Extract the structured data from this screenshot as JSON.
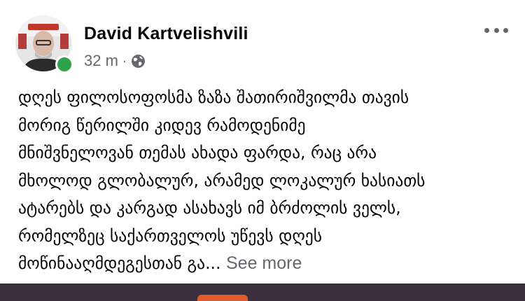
{
  "post": {
    "author": "David Kartvelishvili",
    "time": "32 m",
    "separator": "·",
    "privacy_icon": "globe-icon",
    "more_icon": "more-horizontal-icon",
    "text_lines": [
      "დღეს ფილოსოფოსმა ზაზა შათირიშვილმა თავის",
      "მორიგ წერილში კიდევ რამოდენიმე",
      "მნიშვნელოვან თემას ახადა ფარდა, რაც არა",
      "მხოლოდ გლობალურ, არამედ ლოკალურ ხასიათს",
      "ატარებს და კარგად ასახავს იმ ბრძოლის ველს,",
      "რომელზეც საქართველოს უწევს დღეს"
    ],
    "last_line": "მოწინააღმდეგესთან გა...",
    "see_more": "See more"
  },
  "colors": {
    "online": "#31a24c",
    "secondary_text": "#65676b",
    "bottom_bar": "#3c2f3d"
  }
}
